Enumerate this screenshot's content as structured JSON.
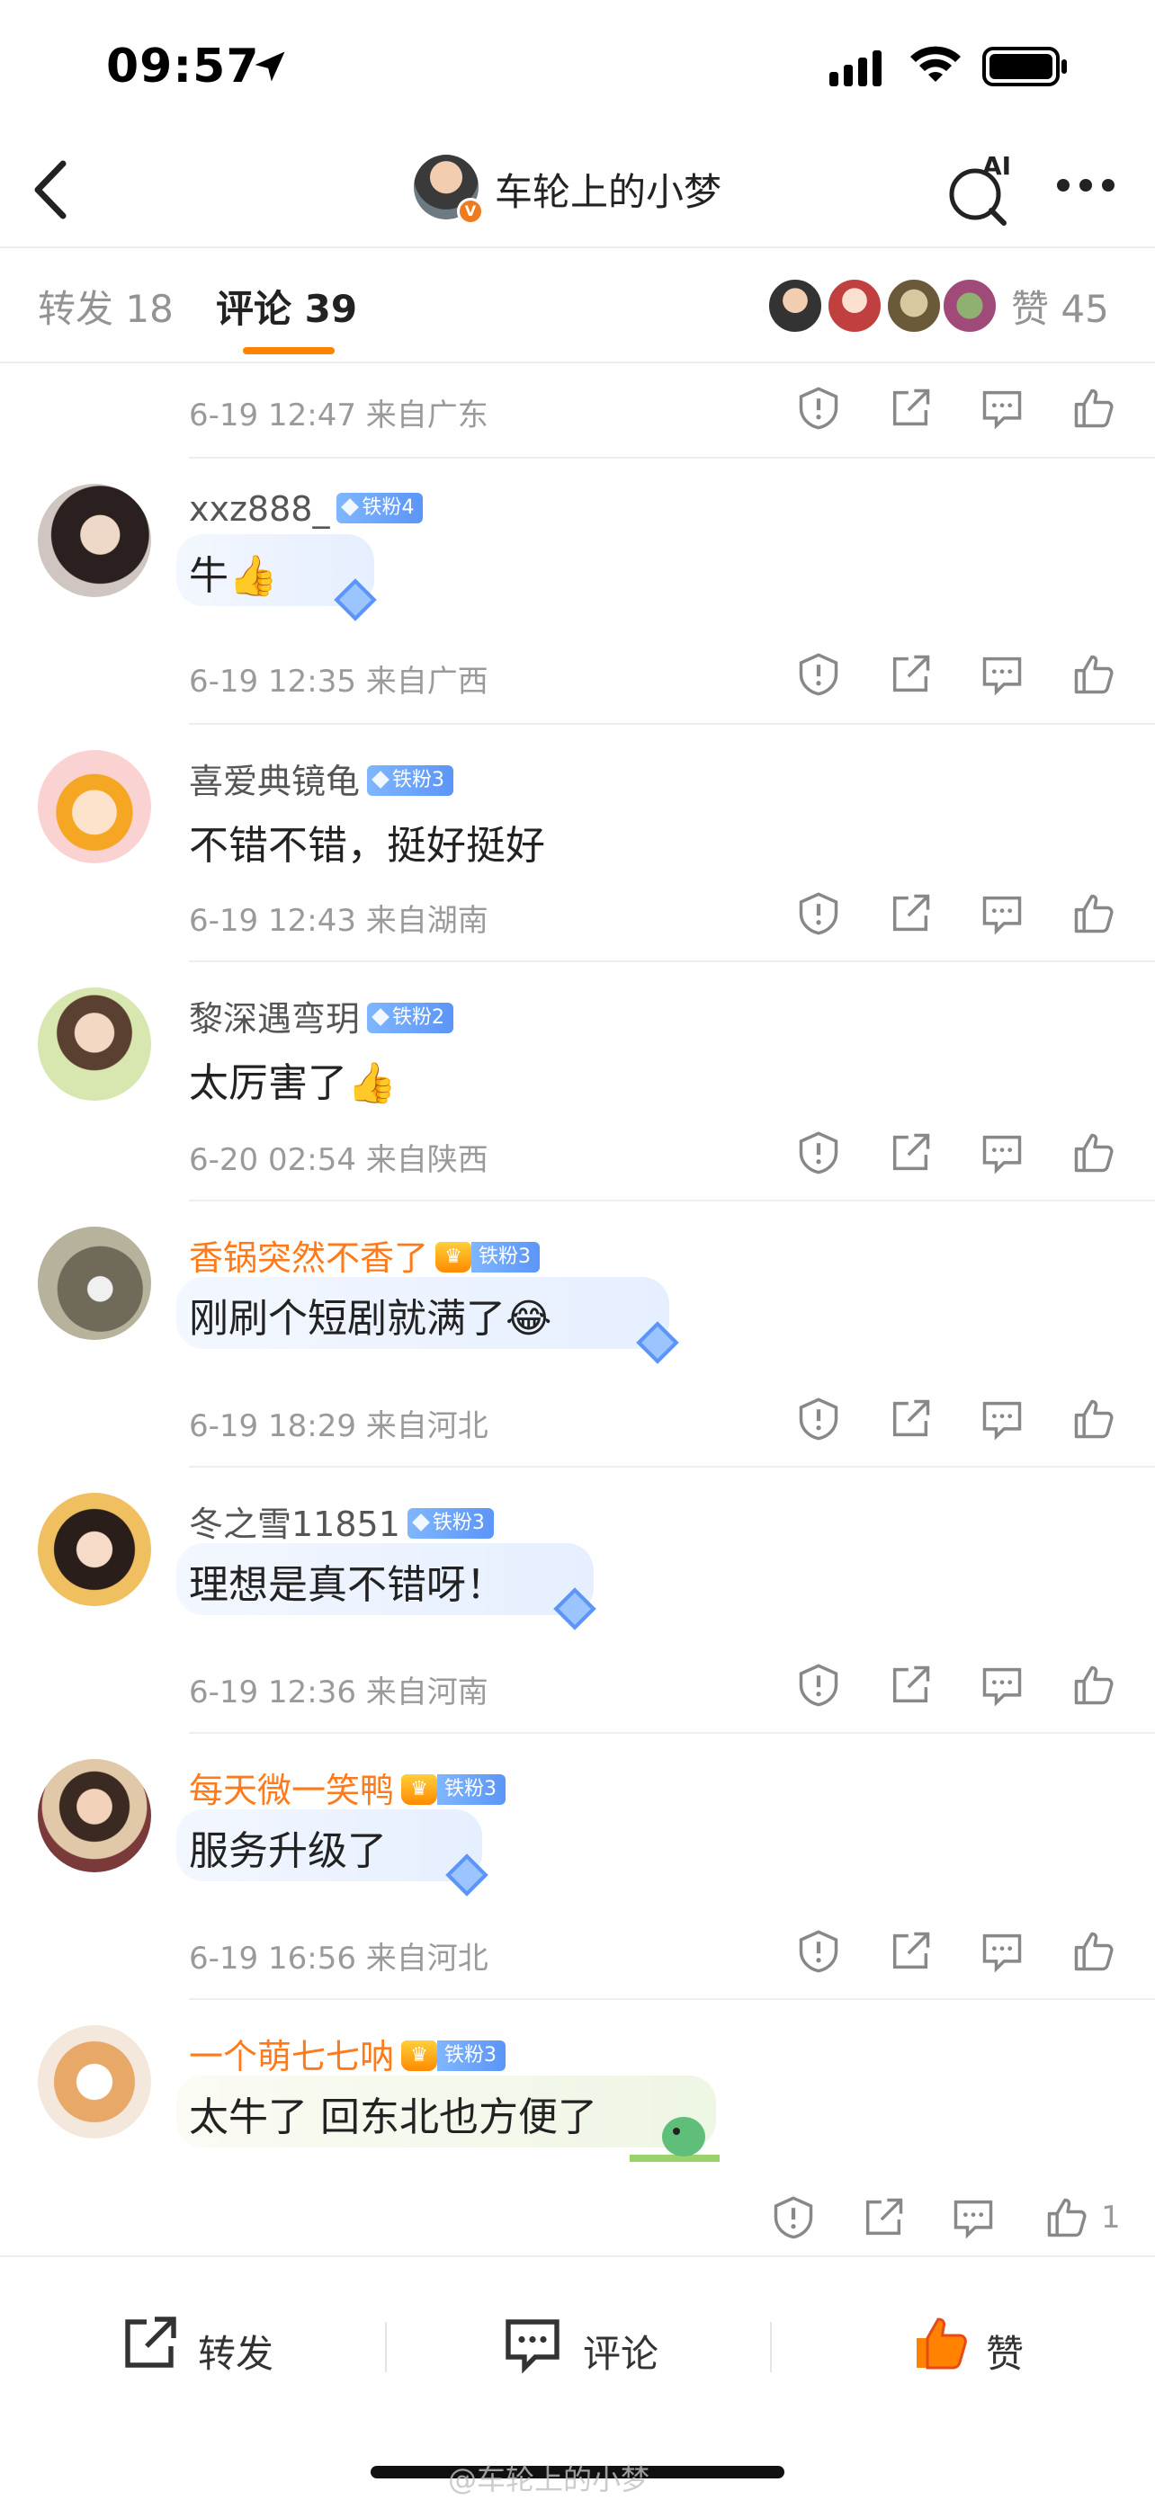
{
  "status_bar": {
    "time": "09:57"
  },
  "nav": {
    "title": "车轮上的小梦",
    "ai_label": "AI"
  },
  "tabs": {
    "repost": "转发 18",
    "comment": "评论 39",
    "like": "赞 45"
  },
  "comments": [
    {
      "user": "",
      "fan": "",
      "text": "",
      "meta": "6-19 12:47  来自广东",
      "likes": ""
    },
    {
      "user": "xxz888_",
      "fan": "铁粉4",
      "text": "牛👍",
      "meta": "6-19 12:35  来自广西",
      "likes": ""
    },
    {
      "user": "喜爱典镜龟",
      "fan": "铁粉3",
      "text": "不错不错，挺好挺好",
      "meta": "6-19 12:43  来自湖南",
      "likes": ""
    },
    {
      "user": "黎深遇弯玥",
      "fan": "铁粉2",
      "text": "太厉害了👍",
      "meta": "6-20 02:54  来自陕西",
      "likes": ""
    },
    {
      "user": "香锅突然不香了",
      "fan": "铁粉3",
      "text": "刚刷个短剧就满了😂",
      "meta": "6-19 18:29  来自河北",
      "likes": ""
    },
    {
      "user": "冬之雪11851",
      "fan": "铁粉3",
      "text": "理想是真不错呀！",
      "meta": "6-19 12:36  来自河南",
      "likes": ""
    },
    {
      "user": "每天微一笑鸭",
      "fan": "铁粉3",
      "text": "服务升级了",
      "meta": "6-19 16:56  来自河北",
      "likes": ""
    },
    {
      "user": "一个萌七七呐",
      "fan": "铁粉3",
      "text": "太牛了 回东北也方便了",
      "meta": "",
      "likes": "1"
    }
  ],
  "bottom_bar": {
    "repost": "转发",
    "comment": "评论",
    "like": "赞"
  },
  "watermark": "@车轮上的小梦",
  "colors": {
    "accent": "#ff8200",
    "vip_name": "#ff7a1a",
    "fan_badge": "#5b95f7"
  }
}
